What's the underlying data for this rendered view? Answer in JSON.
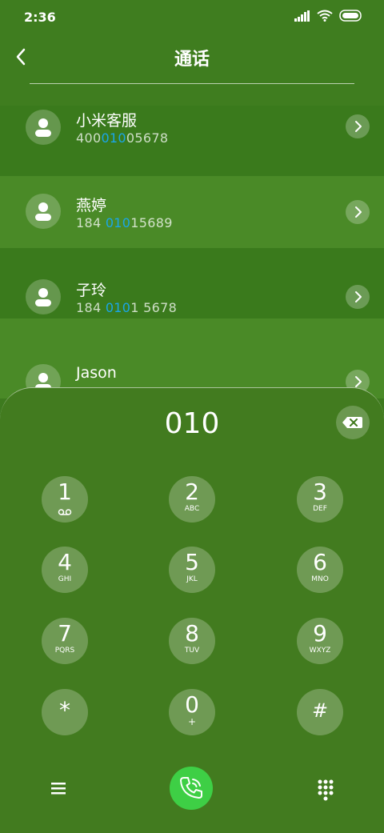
{
  "status": {
    "time": "2:36"
  },
  "header": {
    "title": "通话"
  },
  "contacts": [
    {
      "name": "小米客服",
      "num_pre": "400",
      "num_hl": "010",
      "num_post": "05678"
    },
    {
      "name": "燕婷",
      "num_pre": "184 ",
      "num_hl": "010",
      "num_post": "15689"
    },
    {
      "name": "子玲",
      "num_pre": "184 ",
      "num_hl": "010",
      "num_post": "1 5678"
    },
    {
      "name": "Jason",
      "num_pre": "",
      "num_hl": "",
      "num_post": ""
    }
  ],
  "dialpad": {
    "input": "010",
    "keys": [
      {
        "digit": "1",
        "letters": ""
      },
      {
        "digit": "2",
        "letters": "ABC"
      },
      {
        "digit": "3",
        "letters": "DEF"
      },
      {
        "digit": "4",
        "letters": "GHI"
      },
      {
        "digit": "5",
        "letters": "JKL"
      },
      {
        "digit": "6",
        "letters": "MNO"
      },
      {
        "digit": "7",
        "letters": "PQRS"
      },
      {
        "digit": "8",
        "letters": "TUV"
      },
      {
        "digit": "9",
        "letters": "WXYZ"
      },
      {
        "digit": "*",
        "letters": ""
      },
      {
        "digit": "0",
        "letters": "+"
      },
      {
        "digit": "#",
        "letters": ""
      }
    ]
  },
  "icons": {
    "back": "chevron-left-icon",
    "backspace": "backspace-icon",
    "voicemail": "voicemail-icon",
    "menu": "menu-icon",
    "call": "phone-icon",
    "dialpad_toggle": "dialpad-icon"
  },
  "colors": {
    "background": "#3d7a1e",
    "highlight": "#1aa6e8",
    "call_button": "#3ecf45"
  }
}
